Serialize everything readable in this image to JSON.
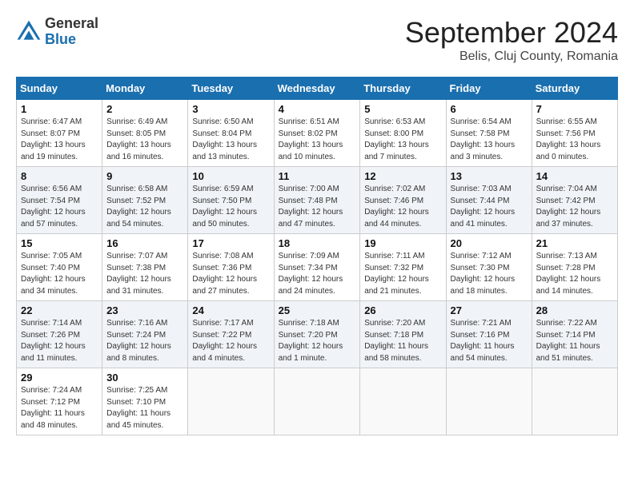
{
  "header": {
    "logo_general": "General",
    "logo_blue": "Blue",
    "month_title": "September 2024",
    "location": "Belis, Cluj County, Romania"
  },
  "days_of_week": [
    "Sunday",
    "Monday",
    "Tuesday",
    "Wednesday",
    "Thursday",
    "Friday",
    "Saturday"
  ],
  "weeks": [
    [
      {
        "day": "1",
        "info": "Sunrise: 6:47 AM\nSunset: 8:07 PM\nDaylight: 13 hours and 19 minutes."
      },
      {
        "day": "2",
        "info": "Sunrise: 6:49 AM\nSunset: 8:05 PM\nDaylight: 13 hours and 16 minutes."
      },
      {
        "day": "3",
        "info": "Sunrise: 6:50 AM\nSunset: 8:04 PM\nDaylight: 13 hours and 13 minutes."
      },
      {
        "day": "4",
        "info": "Sunrise: 6:51 AM\nSunset: 8:02 PM\nDaylight: 13 hours and 10 minutes."
      },
      {
        "day": "5",
        "info": "Sunrise: 6:53 AM\nSunset: 8:00 PM\nDaylight: 13 hours and 7 minutes."
      },
      {
        "day": "6",
        "info": "Sunrise: 6:54 AM\nSunset: 7:58 PM\nDaylight: 13 hours and 3 minutes."
      },
      {
        "day": "7",
        "info": "Sunrise: 6:55 AM\nSunset: 7:56 PM\nDaylight: 13 hours and 0 minutes."
      }
    ],
    [
      {
        "day": "8",
        "info": "Sunrise: 6:56 AM\nSunset: 7:54 PM\nDaylight: 12 hours and 57 minutes."
      },
      {
        "day": "9",
        "info": "Sunrise: 6:58 AM\nSunset: 7:52 PM\nDaylight: 12 hours and 54 minutes."
      },
      {
        "day": "10",
        "info": "Sunrise: 6:59 AM\nSunset: 7:50 PM\nDaylight: 12 hours and 50 minutes."
      },
      {
        "day": "11",
        "info": "Sunrise: 7:00 AM\nSunset: 7:48 PM\nDaylight: 12 hours and 47 minutes."
      },
      {
        "day": "12",
        "info": "Sunrise: 7:02 AM\nSunset: 7:46 PM\nDaylight: 12 hours and 44 minutes."
      },
      {
        "day": "13",
        "info": "Sunrise: 7:03 AM\nSunset: 7:44 PM\nDaylight: 12 hours and 41 minutes."
      },
      {
        "day": "14",
        "info": "Sunrise: 7:04 AM\nSunset: 7:42 PM\nDaylight: 12 hours and 37 minutes."
      }
    ],
    [
      {
        "day": "15",
        "info": "Sunrise: 7:05 AM\nSunset: 7:40 PM\nDaylight: 12 hours and 34 minutes."
      },
      {
        "day": "16",
        "info": "Sunrise: 7:07 AM\nSunset: 7:38 PM\nDaylight: 12 hours and 31 minutes."
      },
      {
        "day": "17",
        "info": "Sunrise: 7:08 AM\nSunset: 7:36 PM\nDaylight: 12 hours and 27 minutes."
      },
      {
        "day": "18",
        "info": "Sunrise: 7:09 AM\nSunset: 7:34 PM\nDaylight: 12 hours and 24 minutes."
      },
      {
        "day": "19",
        "info": "Sunrise: 7:11 AM\nSunset: 7:32 PM\nDaylight: 12 hours and 21 minutes."
      },
      {
        "day": "20",
        "info": "Sunrise: 7:12 AM\nSunset: 7:30 PM\nDaylight: 12 hours and 18 minutes."
      },
      {
        "day": "21",
        "info": "Sunrise: 7:13 AM\nSunset: 7:28 PM\nDaylight: 12 hours and 14 minutes."
      }
    ],
    [
      {
        "day": "22",
        "info": "Sunrise: 7:14 AM\nSunset: 7:26 PM\nDaylight: 12 hours and 11 minutes."
      },
      {
        "day": "23",
        "info": "Sunrise: 7:16 AM\nSunset: 7:24 PM\nDaylight: 12 hours and 8 minutes."
      },
      {
        "day": "24",
        "info": "Sunrise: 7:17 AM\nSunset: 7:22 PM\nDaylight: 12 hours and 4 minutes."
      },
      {
        "day": "25",
        "info": "Sunrise: 7:18 AM\nSunset: 7:20 PM\nDaylight: 12 hours and 1 minute."
      },
      {
        "day": "26",
        "info": "Sunrise: 7:20 AM\nSunset: 7:18 PM\nDaylight: 11 hours and 58 minutes."
      },
      {
        "day": "27",
        "info": "Sunrise: 7:21 AM\nSunset: 7:16 PM\nDaylight: 11 hours and 54 minutes."
      },
      {
        "day": "28",
        "info": "Sunrise: 7:22 AM\nSunset: 7:14 PM\nDaylight: 11 hours and 51 minutes."
      }
    ],
    [
      {
        "day": "29",
        "info": "Sunrise: 7:24 AM\nSunset: 7:12 PM\nDaylight: 11 hours and 48 minutes."
      },
      {
        "day": "30",
        "info": "Sunrise: 7:25 AM\nSunset: 7:10 PM\nDaylight: 11 hours and 45 minutes."
      },
      {
        "day": "",
        "info": ""
      },
      {
        "day": "",
        "info": ""
      },
      {
        "day": "",
        "info": ""
      },
      {
        "day": "",
        "info": ""
      },
      {
        "day": "",
        "info": ""
      }
    ]
  ]
}
